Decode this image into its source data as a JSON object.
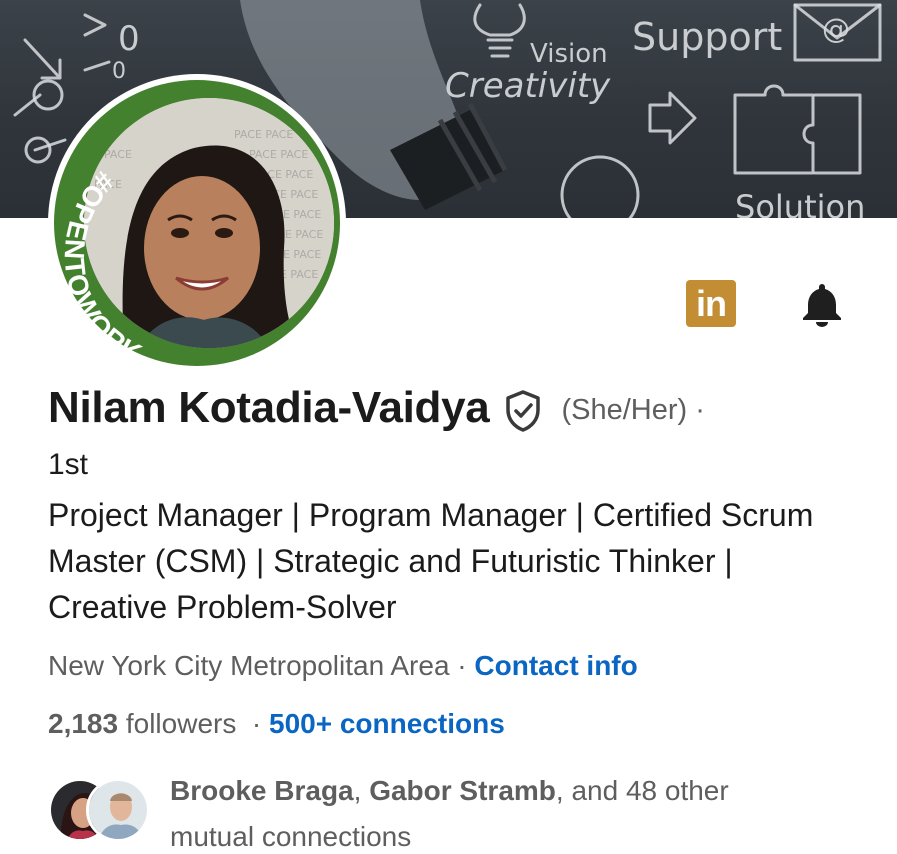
{
  "banner": {
    "words": [
      "Vision",
      "Creativity",
      "Support",
      "Solution"
    ]
  },
  "avatar": {
    "badge_text": "#OPENTOWORK"
  },
  "actions": {
    "linkedin_label": "in",
    "bell_icon": "bell-icon"
  },
  "profile": {
    "name": "Nilam Kotadia-Vaidya",
    "pronouns": "(She/Her) ·",
    "degree": "1st",
    "headline": "Project Manager | Program Manager | Certified Scrum Master (CSM) | Strategic and Futuristic Thinker | Creative Problem-Solver",
    "location": "New York City Metropolitan Area",
    "location_separator": " · ",
    "contact_info": "Contact info",
    "followers_count": "2,183",
    "followers_label": " followers",
    "connections_separator": "  · ",
    "connections": "500+ connections"
  },
  "mutual": {
    "name1": "Brooke Braga",
    "separator": ", ",
    "name2": "Gabor Stramb",
    "rest": ", and 48 other mutual connections"
  },
  "colors": {
    "link": "#0a66c2",
    "open_to_work_green": "#44812e",
    "linkedin_button": "#c38d33"
  }
}
